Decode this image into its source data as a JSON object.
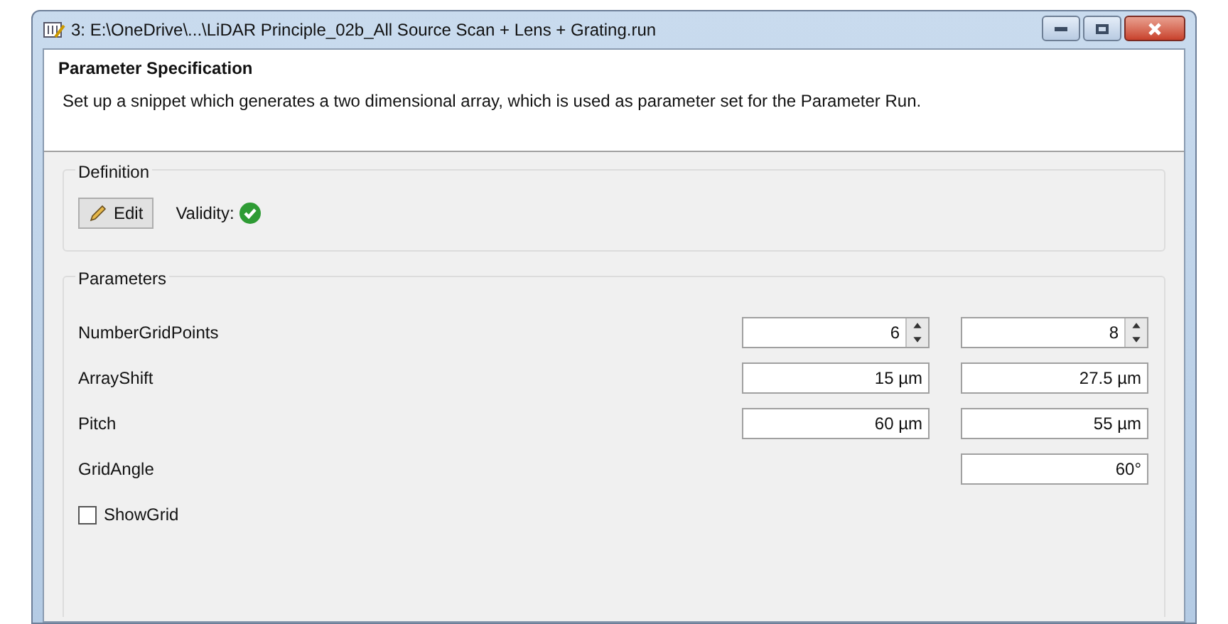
{
  "window": {
    "title": "3: E:\\OneDrive\\...\\LiDAR Principle_02b_All Source Scan + Lens + Grating.run"
  },
  "header": {
    "title": "Parameter Specification",
    "description": "Set up a snippet which generates a two dimensional array, which is used as parameter set for the Parameter Run."
  },
  "definition": {
    "legend": "Definition",
    "edit_button": "Edit",
    "validity_label": "Validity:",
    "valid": true
  },
  "parameters": {
    "legend": "Parameters",
    "rows": [
      {
        "label": "NumberGridPoints",
        "field_1": {
          "kind": "spinner",
          "value": "6"
        },
        "field_2": {
          "kind": "spinner",
          "value": "8"
        }
      },
      {
        "label": "ArrayShift",
        "field_1": {
          "kind": "text",
          "value": "15 µm"
        },
        "field_2": {
          "kind": "text",
          "value": "27.5 µm"
        }
      },
      {
        "label": "Pitch",
        "field_1": {
          "kind": "text",
          "value": "60 µm"
        },
        "field_2": {
          "kind": "text",
          "value": "55 µm"
        }
      },
      {
        "label": "GridAngle",
        "field_2": {
          "kind": "text",
          "value": "60°"
        }
      }
    ],
    "checkbox": {
      "label": "ShowGrid",
      "checked": false
    }
  }
}
